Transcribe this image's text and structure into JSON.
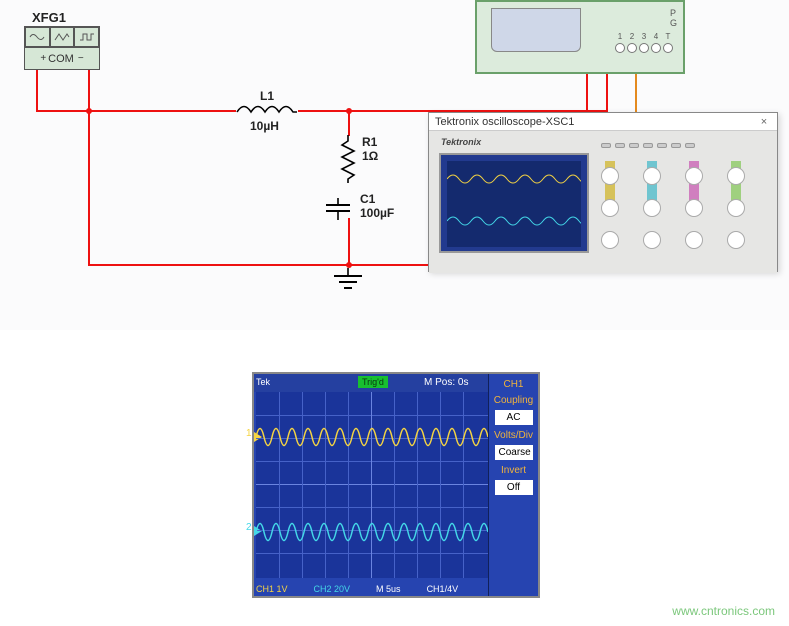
{
  "xfg": {
    "name": "XFG1",
    "com": "COM"
  },
  "scope": {
    "popup_title": "Tektronix oscilloscope-XSC1",
    "brand": "Tektronix",
    "ports": [
      "1",
      "2",
      "3",
      "4"
    ],
    "pg": [
      "P",
      "G"
    ],
    "t": "T"
  },
  "components": {
    "L1": {
      "ref": "L1",
      "value": "10µH"
    },
    "R1": {
      "ref": "R1",
      "value": "1Ω"
    },
    "C1": {
      "ref": "C1",
      "value": "100µF"
    }
  },
  "enlarged": {
    "tek": "Tek",
    "trig": "Trig'd",
    "mpos": "M Pos: 0s",
    "side": {
      "ch": "CH1",
      "coupling": "Coupling",
      "ac": "AC",
      "voltsdiv": "Volts/Div",
      "coarse": "Coarse",
      "invert": "Invert",
      "off": "Off"
    },
    "foot": {
      "ch1": "CH1 1V",
      "ch2": "CH2 20V",
      "m": "M 5us",
      "trg": "CH1/4V"
    },
    "markers": {
      "m1": "1",
      "m2": "2"
    }
  },
  "watermark": "www.cntronics.com"
}
